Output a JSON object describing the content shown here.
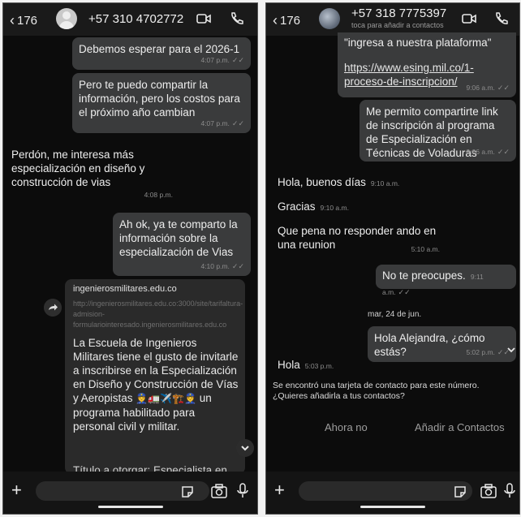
{
  "left": {
    "header": {
      "back_count": "176",
      "phone": "+57 310 4702772"
    },
    "messages": [
      {
        "text": "Debemos esperar para el 2026-1",
        "time": "4:07 p.m."
      },
      {
        "text": "Pero te puedo compartir la información, pero los costos para el próximo año cambian",
        "time": "4:07 p.m."
      },
      {
        "text": "Perdón, me interesa más especialización en diseño y construcción de vias",
        "time": "4:08 p.m."
      },
      {
        "text": "Ah ok, ya te comparto la información sobre la especialización de Vias",
        "time": "4:10 p.m."
      }
    ],
    "link_card": {
      "domain": "ingenierosmilitares.edu.co",
      "url": "http://ingenierosmilitares.edu.co:3000/site/tarifaltura-admision-formulariointeresado.ingenierosmilitares.edu.co",
      "body": "La Escuela de Ingenieros Militares tiene el gusto de invitarle a inscribirse en la Especialización en Diseño y Construcción de Vías y Aeropistas",
      "body_tail": "un programa habilitado para personal civil y militar.",
      "cut_text": "Título a otorgar: Especialista en"
    }
  },
  "right": {
    "header": {
      "back_count": "176",
      "phone": "+57 318 7775397",
      "subtitle": "toca para añadir a contactos"
    },
    "messages": [
      {
        "text": "\"ingresa a nuestra plataforma\""
      },
      {
        "text": "https://www.esing.mil.co/1-proceso-de-inscripcion/",
        "time": "9:06 a.m."
      },
      {
        "text": "Me permito compartirte link de inscripción al programa de Especialización en Técnicas de Voladuras",
        "time": "9:06 a.m."
      },
      {
        "text": "Hola, buenos días",
        "time": "9:10 a.m."
      },
      {
        "text": "Gracias",
        "time": "9:10 a.m."
      },
      {
        "text": "Que pena no responder ando en una reunion",
        "time": "5:10 a.m."
      },
      {
        "text": "No te preocupes.",
        "time": "9:11 a.m."
      },
      {
        "text": "Hola Alejandra, ¿cómo estás?",
        "time": "5:02 p.m."
      },
      {
        "text": "Hola",
        "time": "5:03 p.m."
      }
    ],
    "date_chip": "mar, 24 de jun.",
    "contact_notice": "Se encontró una tarjeta de contacto para este número. ¿Quieres añadirla a tus contactos?",
    "btn_no": "Ahora no",
    "btn_add": "Añadir a Contactos"
  },
  "colors": {
    "background": "#0c0c0c",
    "bubble_out": "#3a3b3c",
    "text": "#ededed"
  },
  "icons": [
    "back-chevron-icon",
    "video-call-icon",
    "phone-call-icon",
    "plus-icon",
    "sticker-icon",
    "camera-icon",
    "microphone-icon",
    "share-icon",
    "chevron-down-icon"
  ]
}
